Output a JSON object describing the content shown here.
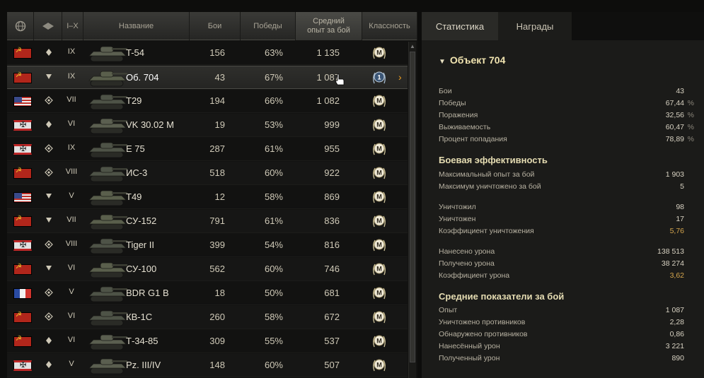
{
  "table": {
    "headers": {
      "nation_icon": "globe-icon",
      "type_icon": "vehicle-class-icon",
      "tier": "I–X",
      "name": "Название",
      "battles": "Бои",
      "wins": "Победы",
      "avg_xp": "Средний опыт за бой",
      "mastery": "Классность"
    },
    "rows": [
      {
        "nation": "ussr",
        "class_icon": "medium-tank-icon",
        "tier": "IX",
        "name": "T-54",
        "battles": "156",
        "wins": "63%",
        "avg_xp": "1 135",
        "badge": "M"
      },
      {
        "nation": "ussr",
        "class_icon": "td-icon",
        "tier": "IX",
        "name": "Об. 704",
        "battles": "43",
        "wins": "67%",
        "avg_xp": "1 087",
        "badge": "1"
      },
      {
        "nation": "usa",
        "class_icon": "heavy-tank-icon",
        "tier": "VII",
        "name": "T29",
        "battles": "194",
        "wins": "66%",
        "avg_xp": "1 082",
        "badge": "M"
      },
      {
        "nation": "germany",
        "class_icon": "medium-tank-icon",
        "tier": "VI",
        "name": "VK 30.02 M",
        "battles": "19",
        "wins": "53%",
        "avg_xp": "999",
        "badge": "M"
      },
      {
        "nation": "germany",
        "class_icon": "heavy-tank-icon",
        "tier": "IX",
        "name": "E 75",
        "battles": "287",
        "wins": "61%",
        "avg_xp": "955",
        "badge": "M"
      },
      {
        "nation": "ussr",
        "class_icon": "heavy-tank-icon",
        "tier": "VIII",
        "name": "ИС-3",
        "battles": "518",
        "wins": "60%",
        "avg_xp": "922",
        "badge": "M"
      },
      {
        "nation": "usa",
        "class_icon": "td-icon",
        "tier": "V",
        "name": "T49",
        "battles": "12",
        "wins": "58%",
        "avg_xp": "869",
        "badge": "M"
      },
      {
        "nation": "ussr",
        "class_icon": "td-icon",
        "tier": "VII",
        "name": "СУ-152",
        "battles": "791",
        "wins": "61%",
        "avg_xp": "836",
        "badge": "M"
      },
      {
        "nation": "germany",
        "class_icon": "heavy-tank-icon",
        "tier": "VIII",
        "name": "Tiger II",
        "battles": "399",
        "wins": "54%",
        "avg_xp": "816",
        "badge": "M"
      },
      {
        "nation": "ussr",
        "class_icon": "td-icon",
        "tier": "VI",
        "name": "СУ-100",
        "battles": "562",
        "wins": "60%",
        "avg_xp": "746",
        "badge": "M"
      },
      {
        "nation": "france",
        "class_icon": "heavy-tank-icon",
        "tier": "V",
        "name": "BDR G1 B",
        "battles": "18",
        "wins": "50%",
        "avg_xp": "681",
        "badge": "M"
      },
      {
        "nation": "ussr",
        "class_icon": "heavy-tank-icon",
        "tier": "VI",
        "name": "КВ-1С",
        "battles": "260",
        "wins": "58%",
        "avg_xp": "672",
        "badge": "M"
      },
      {
        "nation": "ussr",
        "class_icon": "medium-tank-icon",
        "tier": "VI",
        "name": "Т-34-85",
        "battles": "309",
        "wins": "55%",
        "avg_xp": "537",
        "badge": "M"
      },
      {
        "nation": "germany",
        "class_icon": "medium-tank-icon",
        "tier": "V",
        "name": "Pz. III/IV",
        "battles": "148",
        "wins": "60%",
        "avg_xp": "507",
        "badge": "M"
      }
    ],
    "selected_row": 1
  },
  "tabs": [
    "Статистика",
    "Награды"
  ],
  "details": {
    "vehicle_title": "Объект 704",
    "general": [
      {
        "label": "Бои",
        "value": "43",
        "unit": ""
      },
      {
        "label": "Победы",
        "value": "67,44",
        "unit": "%"
      },
      {
        "label": "Поражения",
        "value": "32,56",
        "unit": "%"
      },
      {
        "label": "Выживаемость",
        "value": "60,47",
        "unit": "%"
      },
      {
        "label": "Процент попадания",
        "value": "78,89",
        "unit": "%"
      }
    ],
    "combat_title": "Боевая эффективность",
    "combat": [
      {
        "label": "Максимальный опыт за бой",
        "value": "1 903",
        "unit": ""
      },
      {
        "label": "Максимум уничтожено за бой",
        "value": "5",
        "unit": ""
      },
      {
        "label": "Уничтожил",
        "value": "98",
        "unit": ""
      },
      {
        "label": "Уничтожен",
        "value": "17",
        "unit": ""
      },
      {
        "label": "Коэффициент уничтожения",
        "value": "5,76",
        "unit": ""
      },
      {
        "label": "Нанесено урона",
        "value": "138 513",
        "unit": ""
      },
      {
        "label": "Получено урона",
        "value": "38 274",
        "unit": ""
      },
      {
        "label": "Коэффициент урона",
        "value": "3,62",
        "unit": ""
      }
    ],
    "avg_title": "Средние показатели за бой",
    "avg": [
      {
        "label": "Опыт",
        "value": "1 087",
        "unit": ""
      },
      {
        "label": "Уничтожено противников",
        "value": "2,28",
        "unit": ""
      },
      {
        "label": "Обнаружено противников",
        "value": "0,86",
        "unit": ""
      },
      {
        "label": "Нанесённый урон",
        "value": "3 221",
        "unit": ""
      },
      {
        "label": "Полученный урон",
        "value": "890",
        "unit": ""
      }
    ]
  }
}
